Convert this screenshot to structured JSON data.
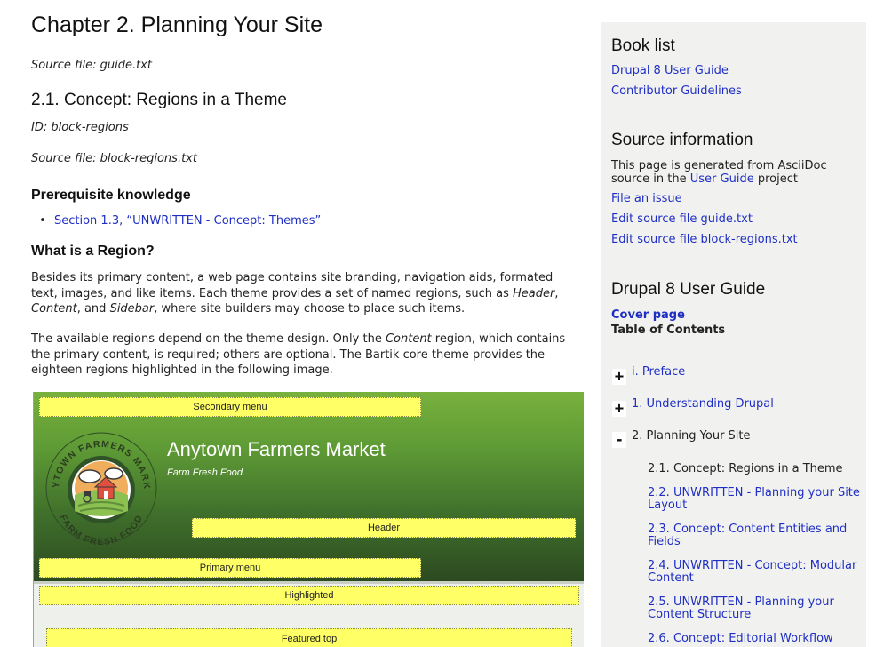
{
  "main": {
    "chapter_title": "Chapter 2. Planning Your Site",
    "chapter_source": "Source file: guide.txt",
    "section_title": "2.1. Concept: Regions in a Theme",
    "section_id": "ID: block-regions",
    "section_source": "Source file: block-regions.txt",
    "prereq_heading": "Prerequisite knowledge",
    "prereq_links": [
      "Section 1.3, “UNWRITTEN - Concept: Themes”"
    ],
    "what_heading": "What is a Region?",
    "para1": {
      "before_header": "Besides its primary content, a web page contains site branding, navigation aids, formated text, images, and like items. Each theme provides a set of named regions, such as ",
      "header": "Header",
      "comma1": ", ",
      "content": "Content",
      "comma2": ", and ",
      "sidebar": "Sidebar",
      "after": ", where site builders may choose to place such items."
    },
    "para2": {
      "before": "The available regions depend on the theme design. Only the ",
      "content": "Content",
      "after": " region, which contains the primary content, is required; others are optional. The Bartik core theme provides the eighteen regions highlighted in the following image."
    }
  },
  "figure": {
    "site_name": "Anytown Farmers Market",
    "site_slogan": "Farm Fresh Food",
    "logo_top_text": "ANYTOWN FARMERS MARKET",
    "logo_bottom_text": "FARM FRESH FOOD",
    "regions": {
      "secondary_menu": "Secondary menu",
      "header": "Header",
      "primary_menu": "Primary menu",
      "highlighted": "Highlighted",
      "featured_top": "Featured top"
    }
  },
  "sidebar": {
    "book_list_heading": "Book list",
    "book_links": [
      "Drupal 8 User Guide",
      "Contributor Guidelines"
    ],
    "source_heading": "Source information",
    "source_text_before": "This page is generated from AsciiDoc source in the ",
    "source_text_link": "User Guide",
    "source_text_after": " project",
    "source_links": [
      "File an issue",
      "Edit source file guide.txt",
      "Edit source file block-regions.txt"
    ],
    "guide_heading": "Drupal 8 User Guide",
    "cover_page": "Cover page",
    "toc_label": "Table of Contents",
    "toc": [
      {
        "toggle": "+",
        "label": "i. Preface"
      },
      {
        "toggle": "+",
        "label": "1. Understanding Drupal"
      },
      {
        "toggle": "-",
        "label": "2. Planning Your Site"
      }
    ],
    "toc_children": [
      "2.1. Concept: Regions in a Theme",
      "2.2. UNWRITTEN - Planning your Site Layout",
      "2.3. Concept: Content Entities and Fields",
      "2.4. UNWRITTEN - Concept: Modular Content",
      "2.5. UNWRITTEN - Planning your Content Structure",
      "2.6. Concept: Editorial Workflow"
    ]
  }
}
